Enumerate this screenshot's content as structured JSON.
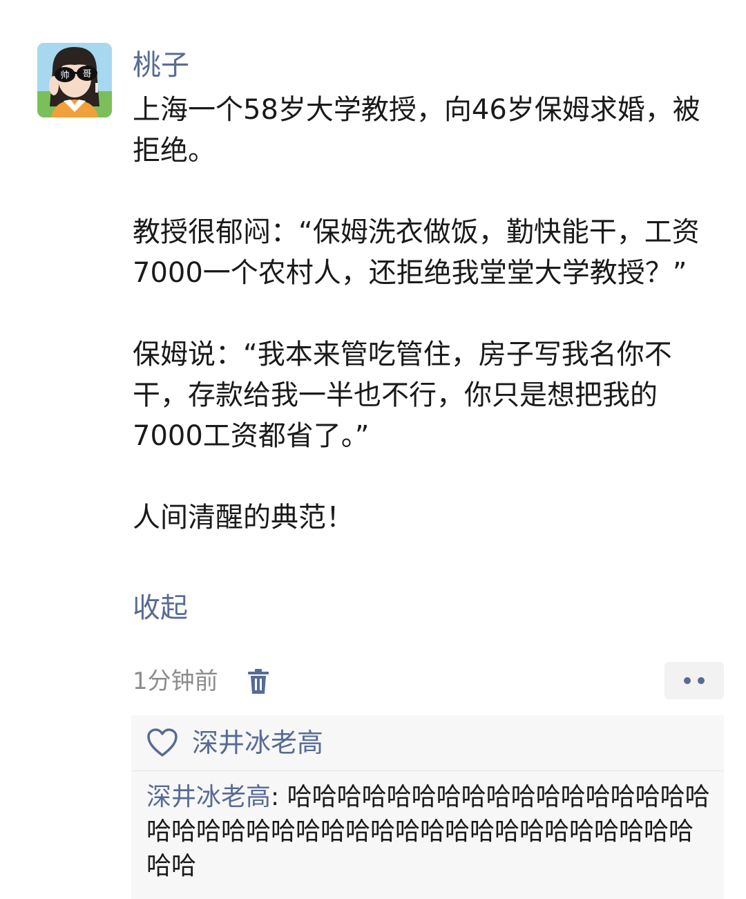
{
  "author": {
    "name": "桃子",
    "avatar": {
      "glasses_text_left": "帅",
      "glasses_text_right": "哥"
    }
  },
  "post": {
    "paragraphs": [
      "上海一个58岁大学教授，向46岁保姆求婚，被拒绝。",
      "教授很郁闷：“保姆洗衣做饭，勤快能干，工资7000一个农村人，还拒绝我堂堂大学教授？”",
      "保姆说：“我本来管吃管住，房子写我名你不干，存款给我一半也不行，你只是想把我的7000工资都省了。”",
      "人间清醒的典范！"
    ],
    "collapse_label": "收起"
  },
  "meta": {
    "time": "1分钟前",
    "delete_icon": "trash-icon",
    "more_icon": "more-dots-icon"
  },
  "interactions": {
    "like_icon": "heart-outline-icon",
    "likes": [
      "深井冰老高"
    ],
    "comments": [
      {
        "author": "深井冰老高",
        "separator": ": ",
        "text": "哈哈哈哈哈哈哈哈哈哈哈哈哈哈哈哈哈哈哈哈哈哈哈哈哈哈哈哈哈哈哈哈哈哈哈哈哈哈哈哈哈"
      }
    ]
  },
  "colors": {
    "link": "#576b95",
    "text": "#1a1a1a",
    "muted": "#8c8c8c",
    "panel": "#f7f7f7"
  }
}
